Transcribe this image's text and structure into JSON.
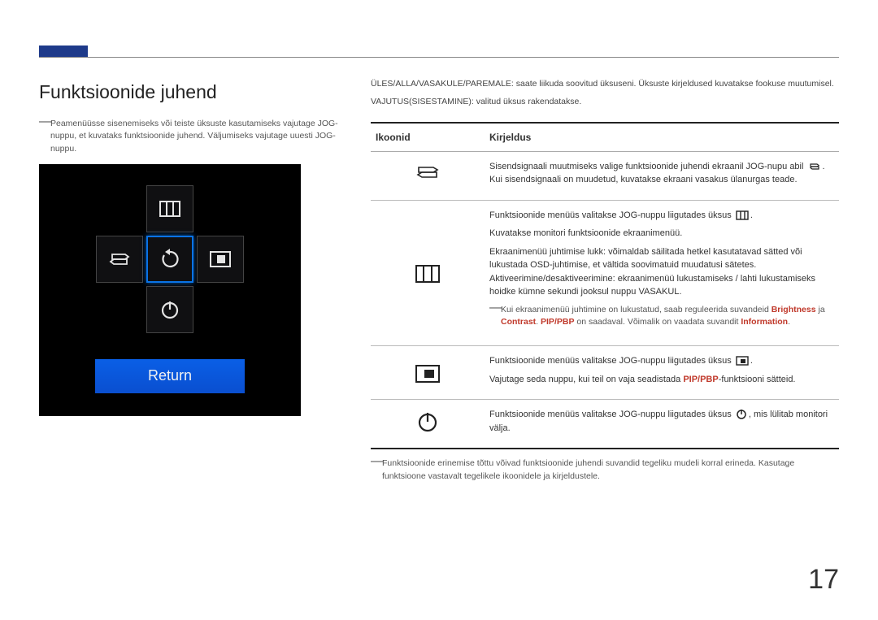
{
  "page_number": "17",
  "left": {
    "heading": "Funktsioonide juhend",
    "note": "Peamenüüsse sisenemiseks või teiste üksuste kasutamiseks vajutage JOG-nuppu, et kuvataks funktsioonide juhend. Väljumiseks vajutage uuesti JOG-nuppu.",
    "return_label": "Return"
  },
  "right": {
    "line1": "ÜLES/ALLA/VASAKULE/PAREMALE: saate liikuda soovitud üksuseni. Üksuste kirjeldused kuvatakse fookuse muutumisel.",
    "line2": "VAJUTUS(SISESTAMINE): valitud üksus rakendatakse.",
    "th_icon": "Ikoonid",
    "th_desc": "Kirjeldus",
    "row1": {
      "p1a": "Sisendsignaali muutmiseks valige funktsioonide juhendi ekraanil JOG-nupu abil ",
      "p1b": ". Kui sisendsignaali on muudetud, kuvatakse ekraani vasakus ülanurgas teade."
    },
    "row2": {
      "p1a": "Funktsioonide menüüs valitakse JOG-nuppu liigutades üksus ",
      "p1b": ".",
      "p2": "Kuvatakse monitori funktsioonide ekraanimenüü.",
      "p3": "Ekraanimenüü juhtimise lukk: võimaldab säilitada hetkel kasutatavad sätted või lukustada OSD-juhtimise, et vältida soovimatuid muudatusi sätetes. Aktiveerimine/desaktiveerimine: ekraanimenüü lukustamiseks / lahti lukustamiseks hoidke kümne sekundi jooksul nuppu VASAKUL.",
      "note_a": "Kui ekraanimenüü juhtimine on lukustatud, saab reguleerida suvandeid ",
      "note_b": " ja ",
      "note_c": ". ",
      "note_d": " on saadaval. Võimalik on vaadata suvandit ",
      "note_e": ".",
      "brightness": "Brightness",
      "contrast": "Contrast",
      "pip_pbp": "PIP/PBP",
      "information": "Information"
    },
    "row3": {
      "p1a": "Funktsioonide menüüs valitakse JOG-nuppu liigutades üksus ",
      "p1b": ".",
      "p2a": "Vajutage seda nuppu, kui teil on vaja seadistada ",
      "p2b": "-funktsiooni sätteid.",
      "pip_pbp": "PIP/PBP"
    },
    "row4": {
      "p1a": "Funktsioonide menüüs valitakse JOG-nuppu liigutades üksus ",
      "p1b": ", mis lülitab monitori välja."
    },
    "after": "Funktsioonide erinemise tõttu võivad funktsioonide juhendi suvandid tegeliku mudeli korral erineda. Kasutage funktsioone vastavalt tegelikele ikoonidele ja kirjeldustele."
  }
}
